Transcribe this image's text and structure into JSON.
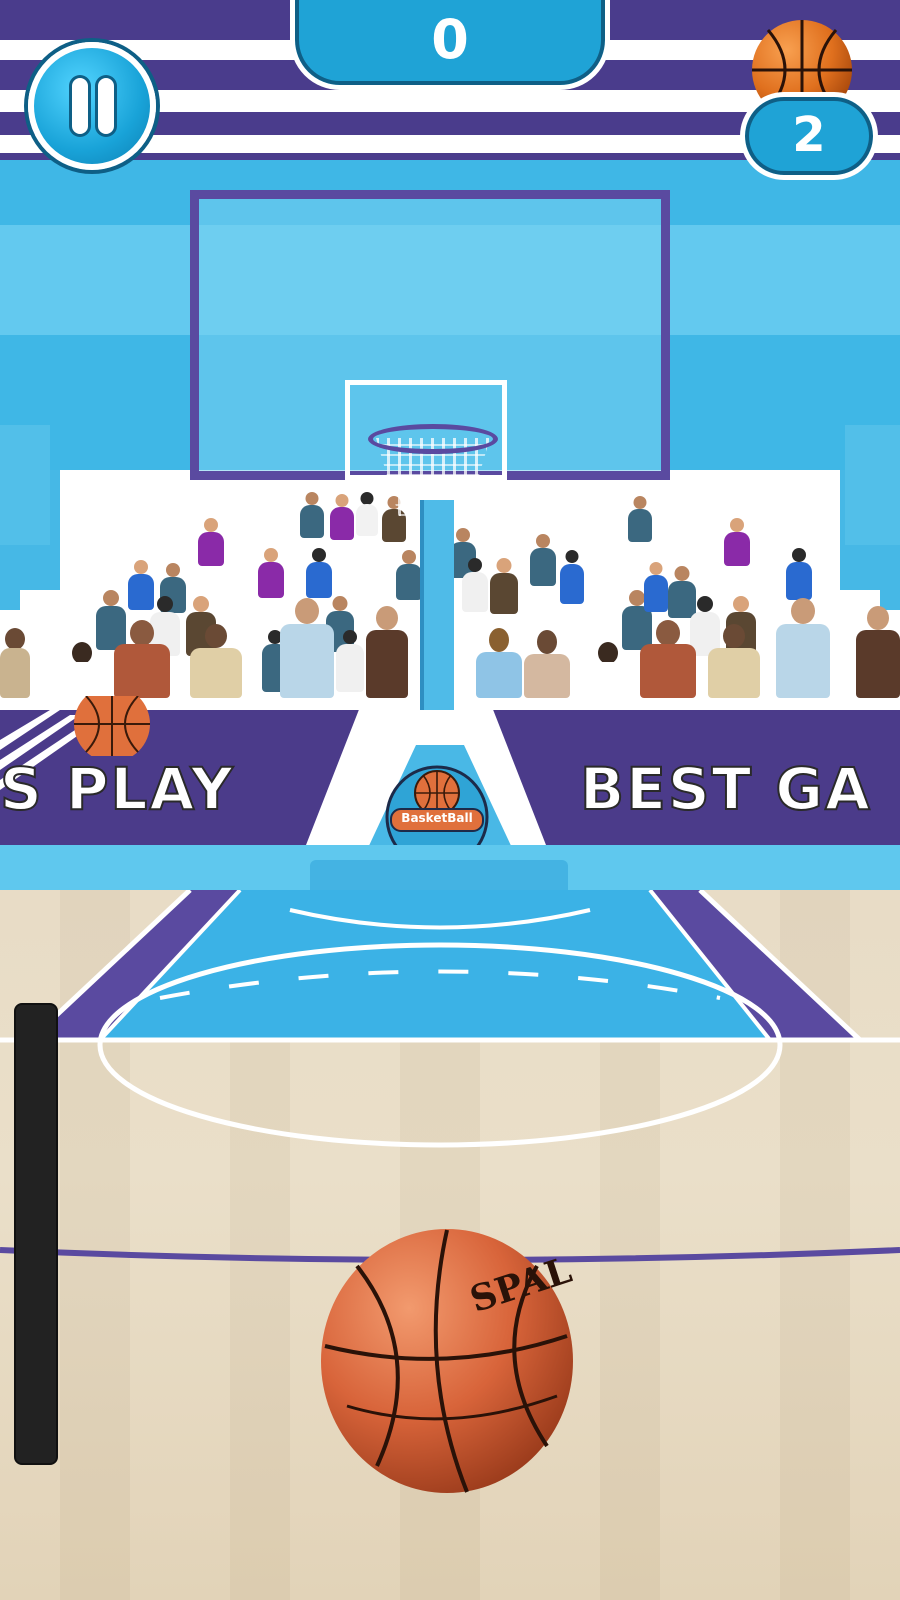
{
  "hud": {
    "score": "0",
    "balls_remaining": "2",
    "pause_icon": "pause-icon",
    "balls_icon": "basketball-icon"
  },
  "banner": {
    "left_text": "S PLAY",
    "right_text": "BEST GA",
    "logo_text": "BasketBall",
    "ball_brand_text": "SPAL"
  },
  "power_meter": {
    "level": 0
  },
  "colors": {
    "purple": "#4a3c8c",
    "cyan": "#3fb7e6",
    "hud_blue": "#1fa3d6",
    "ball_orange": "#d8643a",
    "court_wood": "#e8dcc6"
  }
}
